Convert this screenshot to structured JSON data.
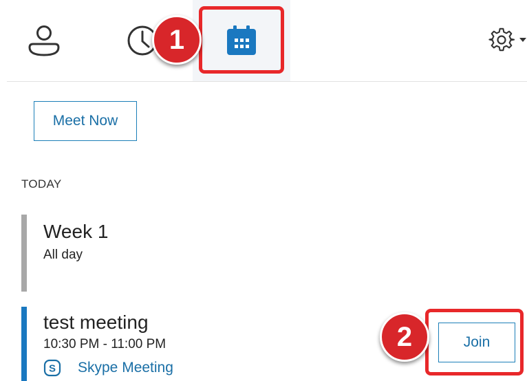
{
  "tabs": [
    {
      "name": "contacts",
      "icon": "person-icon"
    },
    {
      "name": "recent",
      "icon": "clock-icon"
    },
    {
      "name": "meetings",
      "icon": "calendar-icon",
      "selected": true
    }
  ],
  "settings": {
    "icon": "gear-icon",
    "dropdown_icon": "caret-down-icon"
  },
  "main": {
    "meet_now_label": "Meet Now",
    "section_label": "TODAY"
  },
  "meetings": [
    {
      "title": "Week 1",
      "subtitle": "All day",
      "status_color": "#a8a8a8"
    },
    {
      "title": "test meeting",
      "subtitle": "10:30 PM - 11:00 PM",
      "link_label": "Skype Meeting",
      "link_icon": "skype-icon",
      "join_label": "Join",
      "status_color": "#1a78c0"
    }
  ],
  "callouts": [
    {
      "number": "1",
      "target": "meetings-tab"
    },
    {
      "number": "2",
      "target": "join-button"
    }
  ],
  "colors": {
    "accent": "#1a6fa6",
    "callout_red": "#d8262a"
  }
}
